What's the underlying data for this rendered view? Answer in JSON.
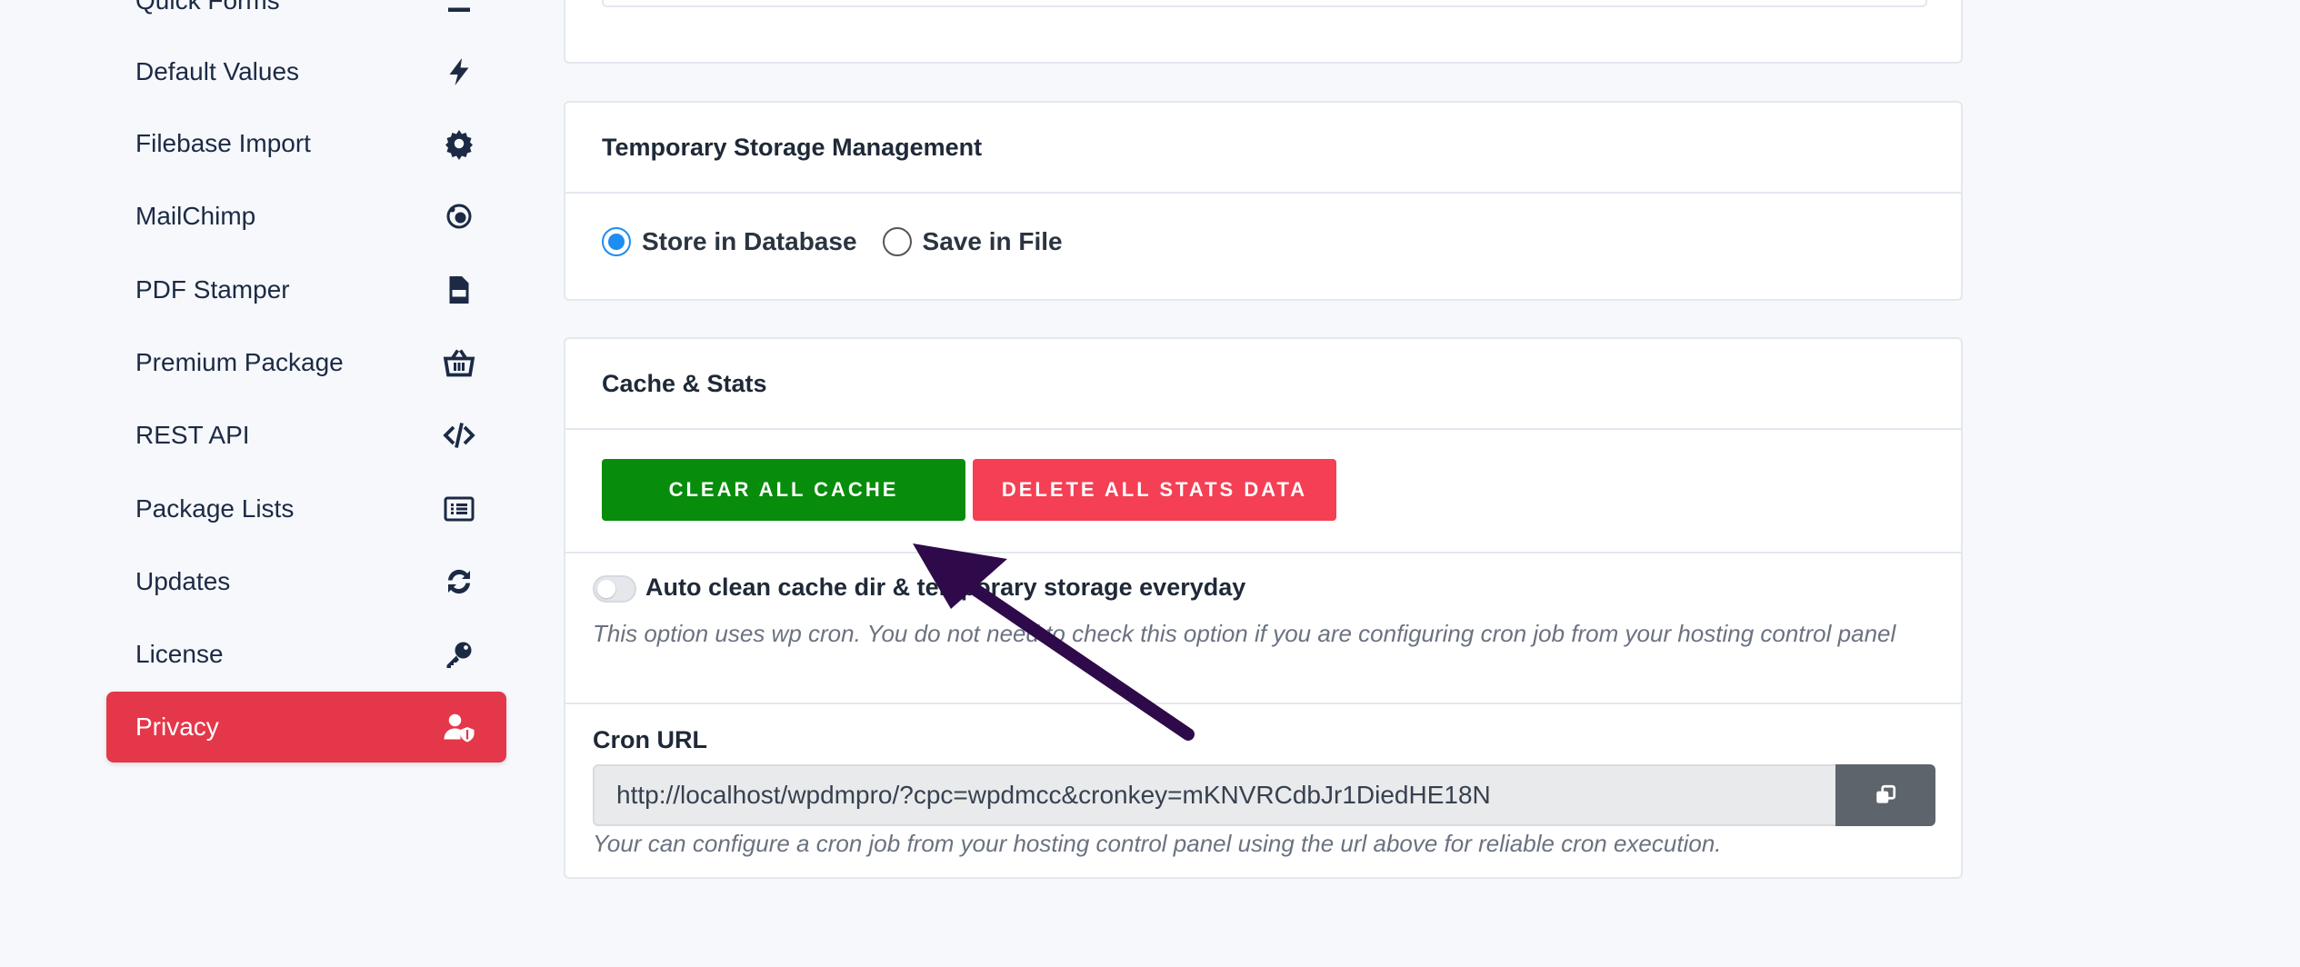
{
  "sidebar": {
    "items": [
      {
        "label": "Quick Forms",
        "icon": "list-icon"
      },
      {
        "label": "Default Values",
        "icon": "bolt-icon"
      },
      {
        "label": "Filebase Import",
        "icon": "gear-icon"
      },
      {
        "label": "MailChimp",
        "icon": "mailchimp-icon"
      },
      {
        "label": "PDF Stamper",
        "icon": "pdf-file-icon"
      },
      {
        "label": "Premium Package",
        "icon": "basket-icon"
      },
      {
        "label": "REST API",
        "icon": "code-icon"
      },
      {
        "label": "Package Lists",
        "icon": "list-alt-icon"
      },
      {
        "label": "Updates",
        "icon": "sync-icon"
      },
      {
        "label": "License",
        "icon": "key-icon"
      },
      {
        "label": "Privacy",
        "icon": "user-shield-icon",
        "active": true
      }
    ],
    "active_color": "#e5374a"
  },
  "storage": {
    "title": "Temporary Storage Management",
    "options": [
      {
        "label": "Store in Database",
        "checked": true
      },
      {
        "label": "Save in File",
        "checked": false
      }
    ]
  },
  "cache": {
    "title": "Cache & Stats",
    "clear_button": "CLEAR ALL CACHE",
    "delete_button": "DELETE ALL STATS DATA",
    "clear_color": "#078c0c",
    "delete_color": "#f43f54",
    "auto_clean_label": "Auto clean cache dir & temporary storage everyday",
    "auto_clean_enabled": false,
    "auto_clean_help": "This option uses wp cron. You do not need to check this option if you are configuring cron job from your hosting control panel",
    "cron_label": "Cron URL",
    "cron_url": "http://localhost/wpdmpro/?cpc=wpdmcc&cronkey=mKNVRCdbJr1DiedHE18N",
    "cron_help": "Your can configure a cron job from your hosting control panel using the url above for reliable cron execution."
  },
  "annotation": {
    "arrow_color": "#2e0a4a"
  }
}
